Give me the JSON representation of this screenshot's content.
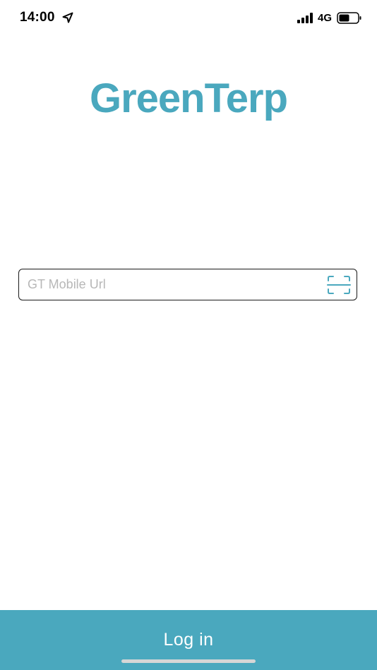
{
  "status_bar": {
    "time": "14:00",
    "network": "4G",
    "icons": [
      "location-arrow-icon",
      "signal-bars-icon",
      "battery-icon"
    ]
  },
  "logo": {
    "text": "GreenTerp"
  },
  "url_field": {
    "placeholder": "GT Mobile Url",
    "value": "",
    "scan_icon": "qr-scan-icon"
  },
  "login_button": {
    "label": "Log in"
  },
  "colors": {
    "brand": "#4aa8be",
    "background": "#ffffff",
    "field_border": "#1a1a1a",
    "placeholder": "#b7b7b7",
    "button_text": "#ffffff"
  }
}
